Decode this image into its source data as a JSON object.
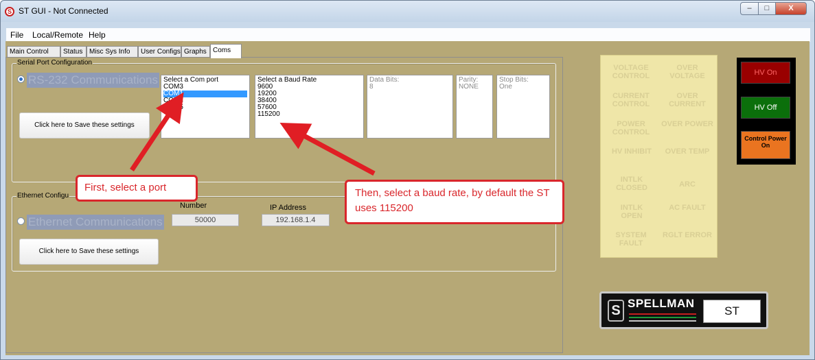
{
  "window": {
    "title": "ST GUI - Not Connected",
    "app_icon": "S",
    "controls": {
      "minimize": "–",
      "maximize": "□",
      "close": "X"
    }
  },
  "menu": [
    "File",
    "Local/Remote",
    "Help"
  ],
  "tabs": [
    "Main Control",
    "Status",
    "Misc Sys Info",
    "User Configs",
    "Graphs",
    "Coms"
  ],
  "active_tab": "Coms",
  "serial": {
    "legend": "Serial Port Configuration",
    "radio_label": "RS-232 Communications",
    "com_port": {
      "header": "Select a Com port",
      "items": [
        "COM3",
        "COM1",
        "COM4",
        "COM5"
      ],
      "selected_index": 1
    },
    "baud": {
      "header": "Select a Baud Rate",
      "items": [
        "9600",
        "19200",
        "38400",
        "57600",
        "115200"
      ]
    },
    "data_bits": {
      "label": "Data Bits:",
      "value": "8"
    },
    "parity": {
      "label": "Parity:",
      "value": "NONE"
    },
    "stop_bits": {
      "label": "Stop Bits:",
      "value": "One"
    },
    "save_label": "Click here to Save these settings"
  },
  "ethernet": {
    "legend": "Ethernet Configu",
    "radio_label": "Ethernet Communications",
    "port_label": "Number",
    "port_value": "50000",
    "ip_label": "IP Address",
    "ip_value": "192.168.1.4",
    "save_label": "Click here to Save these settings"
  },
  "indicators": [
    [
      "VOLTAGE CONTROL",
      "OVER VOLTAGE"
    ],
    [
      "CURRENT CONTROL",
      "OVER CURRENT"
    ],
    [
      "POWER CONTROL",
      "OVER POWER"
    ],
    [
      "HV INHIBIT",
      "OVER TEMP"
    ],
    [
      "INTLK CLOSED",
      "ARC"
    ],
    [
      "INTLK OPEN",
      "AC FAULT"
    ],
    [
      "SYSTEM FAULT",
      "RGLT ERROR"
    ]
  ],
  "hv_controls": {
    "on": "HV On",
    "off": "HV Off",
    "control_power": "Control Power On"
  },
  "logo": {
    "brand": "SPELLMAN",
    "model": "ST",
    "mark": "S"
  },
  "callouts": {
    "port": "First, select a port",
    "baud": "Then, select a baud rate, by default the ST uses 115200"
  },
  "colors": {
    "background": "#b6a876",
    "indicator_panel": "#efe6a8",
    "callout_red": "#d9262b",
    "hv_on": "#990000",
    "hv_off": "#0b6f0b",
    "control_power": "#ea7420"
  }
}
